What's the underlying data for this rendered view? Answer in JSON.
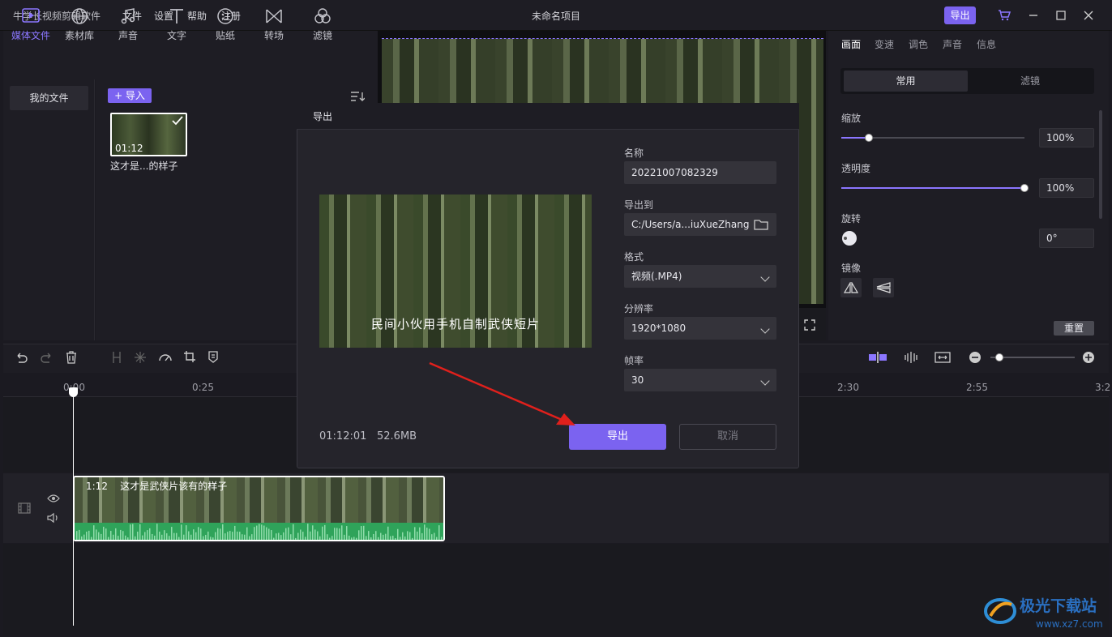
{
  "app": {
    "name": "牛学长视频剪辑软件",
    "project_title": "未命名项目",
    "export_label": "导出"
  },
  "menu": [
    "文件",
    "设置",
    "帮助",
    "注册"
  ],
  "toolbar": [
    {
      "label": "媒体文件",
      "icon": "media-icon",
      "active": true
    },
    {
      "label": "素材库",
      "icon": "globe-icon"
    },
    {
      "label": "声音",
      "icon": "music-icon"
    },
    {
      "label": "文字",
      "icon": "text-icon"
    },
    {
      "label": "贴纸",
      "icon": "sticker-icon"
    },
    {
      "label": "转场",
      "icon": "transition-icon"
    },
    {
      "label": "滤镜",
      "icon": "filter-icon"
    }
  ],
  "media": {
    "my_files": "我的文件",
    "import_label": "+ 导入",
    "clip_duration": "01:12",
    "clip_name": "这才是...的样子"
  },
  "right_panel": {
    "tabs": [
      "画面",
      "变速",
      "调色",
      "声音",
      "信息"
    ],
    "segments": [
      "常用",
      "滤镜"
    ],
    "scale_label": "缩放",
    "scale_value": "100%",
    "scale_level": 0.15,
    "opacity_label": "透明度",
    "opacity_value": "100%",
    "opacity_level": 1.0,
    "rotate_label": "旋转",
    "rotate_value": "0°",
    "mirror_label": "镜像",
    "reset_label": "重置"
  },
  "timeline": {
    "ticks": [
      "0:00",
      "0:25",
      "2:30",
      "2:55",
      "3:2"
    ],
    "clip_duration": "1:12",
    "clip_title": "这才是武侠片该有的样子"
  },
  "dialog": {
    "title": "导出",
    "name_label": "名称",
    "name_value": "20221007082329",
    "path_label": "导出到",
    "path_value": "C:/Users/a...iuXueZhang",
    "format_label": "格式",
    "format_value": "视频(.MP4)",
    "resolution_label": "分辨率",
    "resolution_value": "1920*1080",
    "fps_label": "帧率",
    "fps_value": "30",
    "duration": "01:12:01",
    "size": "52.6MB",
    "export_button": "导出",
    "cancel_button": "取消",
    "preview_subtitle": "民间小伙用手机自制武侠短片"
  },
  "colors": {
    "accent": "#7b63f0",
    "background": "#1b1a21",
    "audio_wave": "#2fa35a",
    "arrow": "#e0201c"
  }
}
